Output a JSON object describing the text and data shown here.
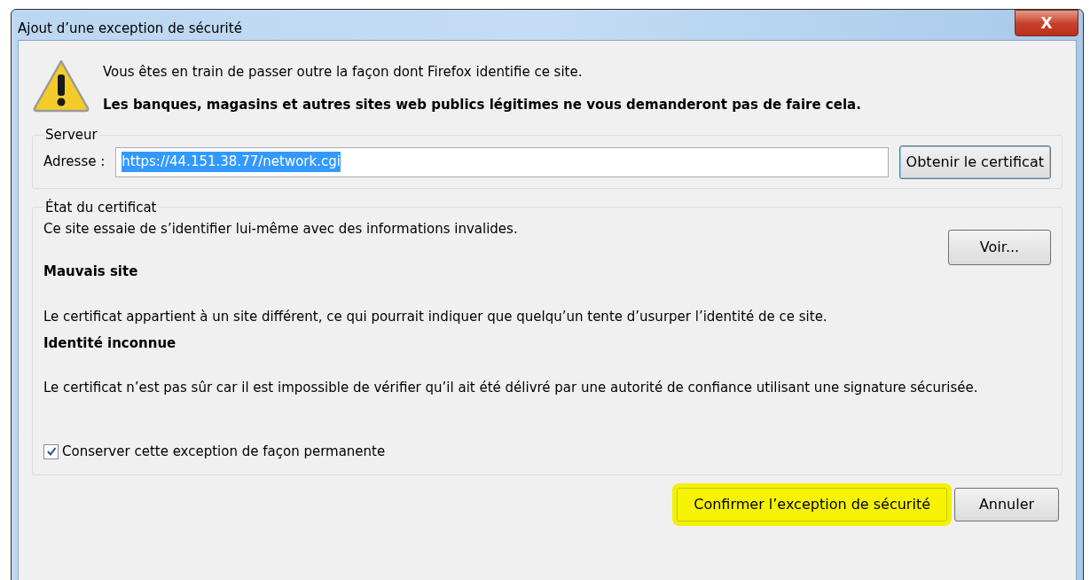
{
  "window": {
    "title": "Ajout d’une exception de sécurité",
    "close": "X"
  },
  "warning": {
    "line": "Vous êtes en train de passer outre la façon dont Firefox identifie ce site.",
    "bold_line": "Les banques, magasins et autres sites web publics légitimes ne vous demanderont pas de faire cela."
  },
  "server": {
    "legend": "Serveur",
    "address_label": "Adresse :",
    "address_value": "https://44.151.38.77/network.cgi",
    "address_selected": true,
    "get_button": "Obtenir le certificat"
  },
  "certificate": {
    "legend": "État du certificat",
    "intro": "Ce site essaie de s’identifier lui-même avec des informations invalides.",
    "view_button": "Voir...",
    "sections": [
      {
        "title": "Mauvais site",
        "text": "Le certificat appartient à un site différent, ce qui pourrait indiquer que quelqu’un tente d’usurper l’identité de ce site."
      },
      {
        "title": "Identité inconnue",
        "text": "Le certificat n’est pas sûr car il est impossible de vérifier qu’il ait été délivré par une autorité de confiance utilisant une signature sécurisée."
      }
    ],
    "permanent": {
      "label": "Conserver cette exception de façon permanente",
      "checked": true
    }
  },
  "buttons": [
    {
      "label": "Confirmer l’exception de sécurité",
      "highlighted": true
    },
    {
      "label": "Annuler",
      "highlighted": false
    }
  ]
}
